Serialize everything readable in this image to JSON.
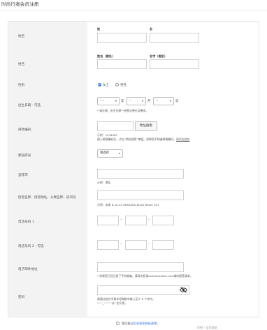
{
  "page": {
    "title": "时尚行者会员注册"
  },
  "rows": {
    "surname": {
      "label": "姓名",
      "family_caption": "姓",
      "given_caption": "名"
    },
    "kana": {
      "label": "姓名",
      "family_caption": "姓名（假名）",
      "given_caption": "名字（假名）"
    },
    "gender": {
      "label": "性别",
      "options": [
        "女士",
        "男性"
      ]
    },
    "birth": {
      "label": "出生日期 - 可选",
      "year": "----",
      "month": "--",
      "day": "--",
      "y_unit": "年",
      "m_unit": "月",
      "d_unit": "日",
      "note": "* 请注意，出生日期一经登记便无法更改。"
    },
    "postal": {
      "label": "邮政编码",
      "value": "",
      "search_button": "地址搜索",
      "example": "示例：1234567",
      "hint": "键入邮政编码后，点击“地址搜索”按钮。如果您不知道邮政编码，",
      "hint_link": "请点击此处"
    },
    "prefecture": {
      "label": "都道府县",
      "selected": "请选择"
    },
    "city": {
      "label": "直辖市",
      "example": "示例：港区"
    },
    "street": {
      "label": "街道名称、街道地址、公寓名称、房间号",
      "example": "示例：赤坂 6-10-34 AKASAKA BLDG Room 101"
    },
    "phone1": {
      "label": "电话号码 1"
    },
    "phone2": {
      "label": "电话号码 2 - 可选"
    },
    "email": {
      "label": "电子邮件地址",
      "note": "* 如果您已经注册了手机邮箱，请再次登录fashionwalker.com域的接受请求。"
    },
    "password": {
      "label": "密码",
      "hint1": "请通过组合半角字母和数字输入至少 6 个字符。",
      "hint2": "\"-\" \"_\" \".\" \"@\" 也可用。"
    }
  },
  "consent": {
    "text_prefix": "我同意",
    "link": "会员条款和隐私政策",
    "text_suffix": "。"
  },
  "footer": {
    "text": "LINE · 会员登录"
  },
  "icons": {
    "eye": "eye-slash-icon",
    "dropdown": "chevron-down-icon"
  }
}
